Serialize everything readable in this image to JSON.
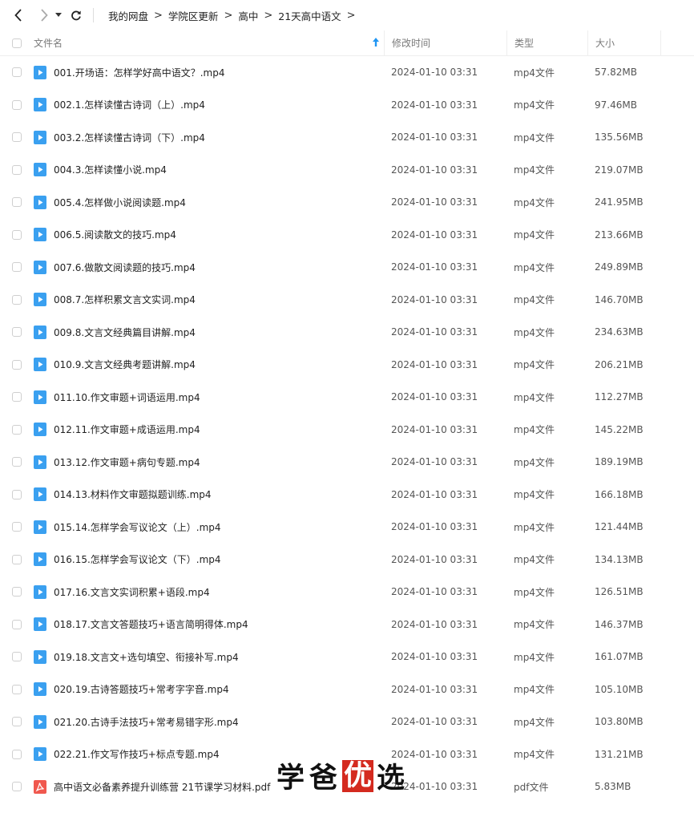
{
  "breadcrumb": [
    "我的网盘",
    "学院区更新",
    "高中",
    "21天高中语文"
  ],
  "columns": {
    "name": "文件名",
    "date": "修改时间",
    "type": "类型",
    "size": "大小"
  },
  "files": [
    {
      "name": "001.开场语：怎样学好高中语文？.mp4",
      "date": "2024-01-10 03:31",
      "type": "mp4文件",
      "size": "57.82MB",
      "icon": "video-file-icon"
    },
    {
      "name": "002.1.怎样读懂古诗词（上）.mp4",
      "date": "2024-01-10 03:31",
      "type": "mp4文件",
      "size": "97.46MB",
      "icon": "video-file-icon"
    },
    {
      "name": "003.2.怎样读懂古诗词（下）.mp4",
      "date": "2024-01-10 03:31",
      "type": "mp4文件",
      "size": "135.56MB",
      "icon": "video-file-icon"
    },
    {
      "name": "004.3.怎样读懂小说.mp4",
      "date": "2024-01-10 03:31",
      "type": "mp4文件",
      "size": "219.07MB",
      "icon": "video-file-icon"
    },
    {
      "name": "005.4.怎样做小说阅读题.mp4",
      "date": "2024-01-10 03:31",
      "type": "mp4文件",
      "size": "241.95MB",
      "icon": "video-file-icon"
    },
    {
      "name": "006.5.阅读散文的技巧.mp4",
      "date": "2024-01-10 03:31",
      "type": "mp4文件",
      "size": "213.66MB",
      "icon": "video-file-icon"
    },
    {
      "name": "007.6.做散文阅读题的技巧.mp4",
      "date": "2024-01-10 03:31",
      "type": "mp4文件",
      "size": "249.89MB",
      "icon": "video-file-icon"
    },
    {
      "name": "008.7.怎样积累文言文实词.mp4",
      "date": "2024-01-10 03:31",
      "type": "mp4文件",
      "size": "146.70MB",
      "icon": "video-file-icon"
    },
    {
      "name": "009.8.文言文经典篇目讲解.mp4",
      "date": "2024-01-10 03:31",
      "type": "mp4文件",
      "size": "234.63MB",
      "icon": "video-file-icon"
    },
    {
      "name": "010.9.文言文经典考题讲解.mp4",
      "date": "2024-01-10 03:31",
      "type": "mp4文件",
      "size": "206.21MB",
      "icon": "video-file-icon"
    },
    {
      "name": "011.10.作文审题+词语运用.mp4",
      "date": "2024-01-10 03:31",
      "type": "mp4文件",
      "size": "112.27MB",
      "icon": "video-file-icon"
    },
    {
      "name": "012.11.作文审题+成语运用.mp4",
      "date": "2024-01-10 03:31",
      "type": "mp4文件",
      "size": "145.22MB",
      "icon": "video-file-icon"
    },
    {
      "name": "013.12.作文审题+病句专题.mp4",
      "date": "2024-01-10 03:31",
      "type": "mp4文件",
      "size": "189.19MB",
      "icon": "video-file-icon"
    },
    {
      "name": "014.13.材料作文审题拟题训练.mp4",
      "date": "2024-01-10 03:31",
      "type": "mp4文件",
      "size": "166.18MB",
      "icon": "video-file-icon"
    },
    {
      "name": "015.14.怎样学会写议论文（上）.mp4",
      "date": "2024-01-10 03:31",
      "type": "mp4文件",
      "size": "121.44MB",
      "icon": "video-file-icon"
    },
    {
      "name": "016.15.怎样学会写议论文（下）.mp4",
      "date": "2024-01-10 03:31",
      "type": "mp4文件",
      "size": "134.13MB",
      "icon": "video-file-icon"
    },
    {
      "name": "017.16.文言文实词积累+语段.mp4",
      "date": "2024-01-10 03:31",
      "type": "mp4文件",
      "size": "126.51MB",
      "icon": "video-file-icon"
    },
    {
      "name": "018.17.文言文答题技巧+语言简明得体.mp4",
      "date": "2024-01-10 03:31",
      "type": "mp4文件",
      "size": "146.37MB",
      "icon": "video-file-icon"
    },
    {
      "name": "019.18.文言文+选句填空、衔接补写.mp4",
      "date": "2024-01-10 03:31",
      "type": "mp4文件",
      "size": "161.07MB",
      "icon": "video-file-icon"
    },
    {
      "name": "020.19.古诗答题技巧+常考字字音.mp4",
      "date": "2024-01-10 03:31",
      "type": "mp4文件",
      "size": "105.10MB",
      "icon": "video-file-icon"
    },
    {
      "name": "021.20.古诗手法技巧+常考易错字形.mp4",
      "date": "2024-01-10 03:31",
      "type": "mp4文件",
      "size": "103.80MB",
      "icon": "video-file-icon"
    },
    {
      "name": "022.21.作文写作技巧+标点专题.mp4",
      "date": "2024-01-10 03:31",
      "type": "mp4文件",
      "size": "131.21MB",
      "icon": "video-file-icon"
    },
    {
      "name": "高中语文必备素养提升训练营 21节课学习材料.pdf",
      "date": "2024-01-10 03:31",
      "type": "pdf文件",
      "size": "5.83MB",
      "icon": "pdf-file-icon"
    }
  ],
  "watermark": {
    "part1": "学爸",
    "part2": "优",
    "part3": "选"
  },
  "colors": {
    "accent": "#2196f3",
    "video_icon": "#3aa0f0",
    "pdf_icon": "#f0584e",
    "watermark_red": "#d42a1f"
  }
}
